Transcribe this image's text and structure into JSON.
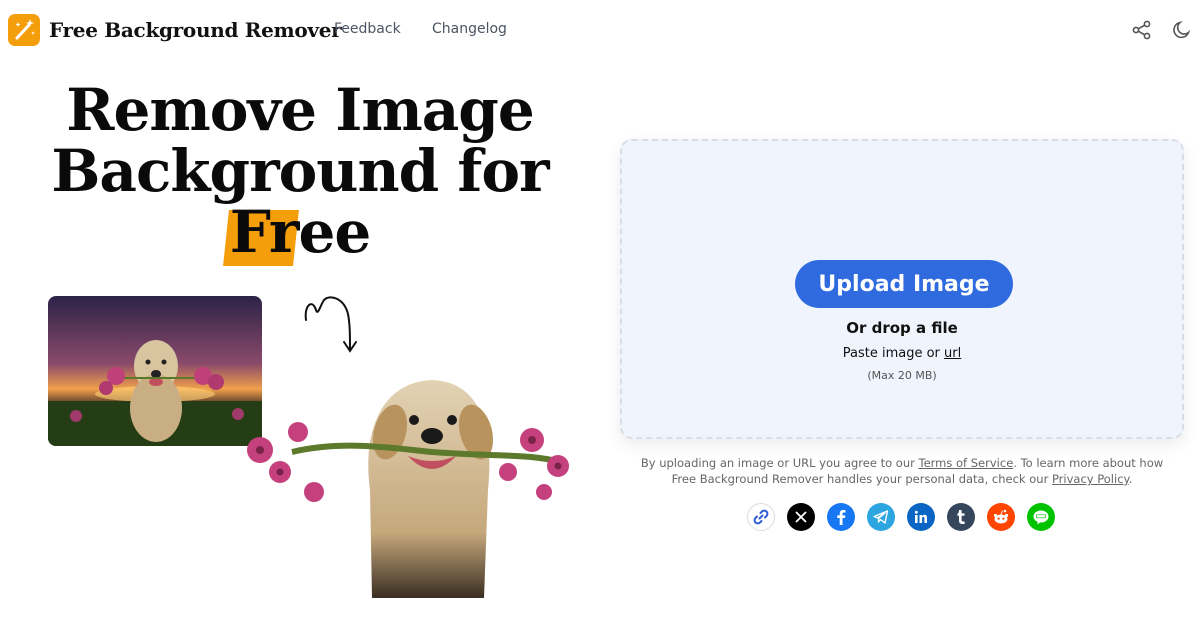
{
  "header": {
    "brand": "Free Background Remover",
    "nav": [
      {
        "label": "Feedback"
      },
      {
        "label": "Changelog"
      }
    ],
    "icons": [
      "share-icon",
      "moon-icon"
    ]
  },
  "hero": {
    "line1": "Remove Image",
    "line2": "Background for",
    "line3_highlight": "Fre",
    "line3_rest": "e"
  },
  "upload": {
    "button_label": "Upload Image",
    "drop_text": "Or drop a file",
    "paste_prefix": "Paste image or ",
    "paste_link": "url",
    "max_text": "(Max 20 MB)"
  },
  "terms": {
    "prefix": "By uploading an image or URL you agree to our ",
    "tos_link": "Terms of Service",
    "middle": ". To learn more about how Free Background Remover handles your personal data, check our ",
    "privacy_link": "Privacy Policy",
    "suffix": "."
  },
  "share": [
    {
      "name": "copy-link-icon",
      "color": "#ffffff"
    },
    {
      "name": "x-icon",
      "color": "#000000"
    },
    {
      "name": "facebook-icon",
      "color": "#1877f2"
    },
    {
      "name": "telegram-icon",
      "color": "#2ca5e0"
    },
    {
      "name": "linkedin-icon",
      "color": "#0a66c2"
    },
    {
      "name": "tumblr-icon",
      "color": "#36465d"
    },
    {
      "name": "reddit-icon",
      "color": "#ff4500"
    },
    {
      "name": "line-icon",
      "color": "#00c300"
    }
  ],
  "colors": {
    "accent": "#f59e0b",
    "primary_button": "#2f6bdf",
    "panel_bg": "#f0f4fc"
  }
}
